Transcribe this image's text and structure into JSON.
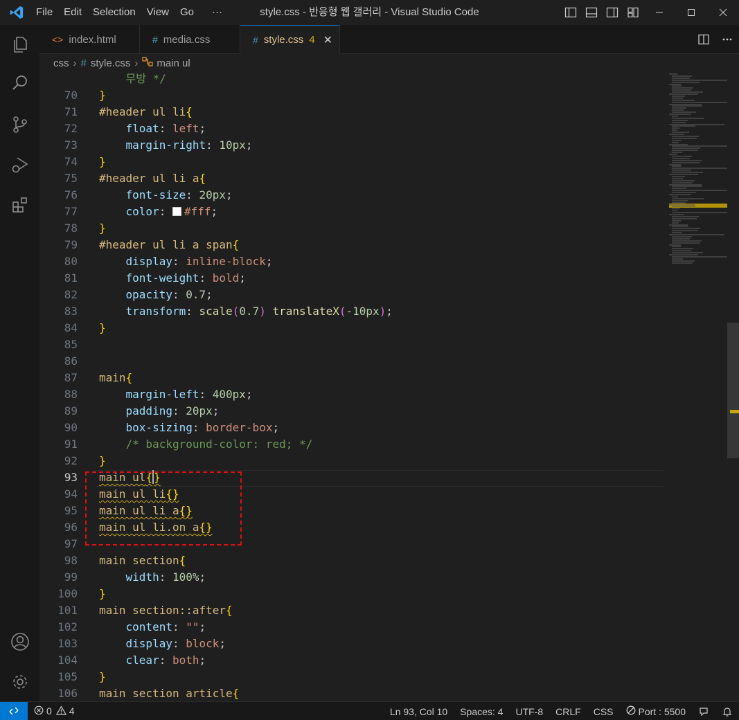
{
  "menu": [
    "File",
    "Edit",
    "Selection",
    "View",
    "Go",
    "···"
  ],
  "window_title": "style.css - 반응형 웹 갤러리 - Visual Studio Code",
  "tabs": [
    {
      "label": "index.html",
      "icon": "<>"
    },
    {
      "label": "media.css",
      "icon": "#"
    },
    {
      "label": "style.css",
      "icon": "#",
      "badge": "4",
      "close": "✕"
    }
  ],
  "breadcrumb": {
    "folder": "css",
    "file": "style.css",
    "symbol": "main ul"
  },
  "code_lines": [
    {
      "n": "",
      "tokens": [
        {
          "t": "    무방 */",
          "c": "cm"
        }
      ]
    },
    {
      "n": "70",
      "tokens": [
        {
          "t": "}",
          "c": "p1"
        }
      ]
    },
    {
      "n": "71",
      "tokens": [
        {
          "t": "#header ul li",
          "c": "sel"
        },
        {
          "t": "{",
          "c": "p1"
        }
      ]
    },
    {
      "n": "72",
      "tokens": [
        {
          "t": "    "
        },
        {
          "t": "float",
          "c": "prop"
        },
        {
          "t": ": ",
          "c": "plain"
        },
        {
          "t": "left",
          "c": "val"
        },
        {
          "t": ";",
          "c": "plain"
        }
      ]
    },
    {
      "n": "73",
      "tokens": [
        {
          "t": "    "
        },
        {
          "t": "margin-right",
          "c": "prop"
        },
        {
          "t": ": ",
          "c": "plain"
        },
        {
          "t": "10px",
          "c": "num"
        },
        {
          "t": ";",
          "c": "plain"
        }
      ]
    },
    {
      "n": "74",
      "tokens": [
        {
          "t": "}",
          "c": "p1"
        }
      ]
    },
    {
      "n": "75",
      "tokens": [
        {
          "t": "#header ul li a",
          "c": "sel"
        },
        {
          "t": "{",
          "c": "p1"
        }
      ]
    },
    {
      "n": "76",
      "tokens": [
        {
          "t": "    "
        },
        {
          "t": "font-size",
          "c": "prop"
        },
        {
          "t": ": ",
          "c": "plain"
        },
        {
          "t": "20px",
          "c": "num"
        },
        {
          "t": ";",
          "c": "plain"
        }
      ]
    },
    {
      "n": "77",
      "tokens": [
        {
          "t": "    "
        },
        {
          "t": "color",
          "c": "prop"
        },
        {
          "t": ": ",
          "c": "plain"
        },
        {
          "t": "",
          "c": "swatch"
        },
        {
          "t": "#fff",
          "c": "val"
        },
        {
          "t": ";",
          "c": "plain"
        }
      ]
    },
    {
      "n": "78",
      "tokens": [
        {
          "t": "}",
          "c": "p1"
        }
      ]
    },
    {
      "n": "79",
      "tokens": [
        {
          "t": "#header ul li a span",
          "c": "sel"
        },
        {
          "t": "{",
          "c": "p1"
        }
      ]
    },
    {
      "n": "80",
      "tokens": [
        {
          "t": "    "
        },
        {
          "t": "display",
          "c": "prop"
        },
        {
          "t": ": ",
          "c": "plain"
        },
        {
          "t": "inline-block",
          "c": "val"
        },
        {
          "t": ";",
          "c": "plain"
        }
      ]
    },
    {
      "n": "81",
      "tokens": [
        {
          "t": "    "
        },
        {
          "t": "font-weight",
          "c": "prop"
        },
        {
          "t": ": ",
          "c": "plain"
        },
        {
          "t": "bold",
          "c": "val"
        },
        {
          "t": ";",
          "c": "plain"
        }
      ]
    },
    {
      "n": "82",
      "tokens": [
        {
          "t": "    "
        },
        {
          "t": "opacity",
          "c": "prop"
        },
        {
          "t": ": ",
          "c": "plain"
        },
        {
          "t": "0.7",
          "c": "num"
        },
        {
          "t": ";",
          "c": "plain"
        }
      ]
    },
    {
      "n": "83",
      "tokens": [
        {
          "t": "    "
        },
        {
          "t": "transform",
          "c": "prop"
        },
        {
          "t": ": ",
          "c": "plain"
        },
        {
          "t": "scale",
          "c": "func"
        },
        {
          "t": "(",
          "c": "p2"
        },
        {
          "t": "0.7",
          "c": "num"
        },
        {
          "t": ")",
          "c": "p2"
        },
        {
          "t": " "
        },
        {
          "t": "translateX",
          "c": "func"
        },
        {
          "t": "(",
          "c": "p2"
        },
        {
          "t": "-10px",
          "c": "num"
        },
        {
          "t": ")",
          "c": "p2"
        },
        {
          "t": ";",
          "c": "plain"
        }
      ]
    },
    {
      "n": "84",
      "tokens": [
        {
          "t": "}",
          "c": "p1"
        }
      ]
    },
    {
      "n": "85",
      "tokens": []
    },
    {
      "n": "86",
      "tokens": []
    },
    {
      "n": "87",
      "tokens": [
        {
          "t": "main",
          "c": "sel"
        },
        {
          "t": "{",
          "c": "p1"
        }
      ]
    },
    {
      "n": "88",
      "tokens": [
        {
          "t": "    "
        },
        {
          "t": "margin-left",
          "c": "prop"
        },
        {
          "t": ": ",
          "c": "plain"
        },
        {
          "t": "400px",
          "c": "num"
        },
        {
          "t": ";",
          "c": "plain"
        }
      ]
    },
    {
      "n": "89",
      "tokens": [
        {
          "t": "    "
        },
        {
          "t": "padding",
          "c": "prop"
        },
        {
          "t": ": ",
          "c": "plain"
        },
        {
          "t": "20px",
          "c": "num"
        },
        {
          "t": ";",
          "c": "plain"
        }
      ]
    },
    {
      "n": "90",
      "tokens": [
        {
          "t": "    "
        },
        {
          "t": "box-sizing",
          "c": "prop"
        },
        {
          "t": ": ",
          "c": "plain"
        },
        {
          "t": "border-box",
          "c": "val"
        },
        {
          "t": ";",
          "c": "plain"
        }
      ]
    },
    {
      "n": "91",
      "tokens": [
        {
          "t": "    "
        },
        {
          "t": "/* background-color: red; */",
          "c": "cm"
        }
      ]
    },
    {
      "n": "92",
      "tokens": [
        {
          "t": "}",
          "c": "p1"
        }
      ]
    },
    {
      "n": "93",
      "current": true,
      "tokens": [
        {
          "t": "main ul",
          "c": "sel squig"
        },
        {
          "t": "{",
          "c": "p1 squig"
        },
        {
          "t": "",
          "c": "caret"
        },
        {
          "t": "}",
          "c": "p1 squig"
        }
      ]
    },
    {
      "n": "94",
      "tokens": [
        {
          "t": "main ul li",
          "c": "sel squig"
        },
        {
          "t": "{}",
          "c": "p1 squig"
        }
      ]
    },
    {
      "n": "95",
      "tokens": [
        {
          "t": "main ul li a",
          "c": "sel squig"
        },
        {
          "t": "{}",
          "c": "p1 squig"
        }
      ]
    },
    {
      "n": "96",
      "tokens": [
        {
          "t": "main ul li.on a",
          "c": "sel squig"
        },
        {
          "t": "{}",
          "c": "p1 squig"
        }
      ]
    },
    {
      "n": "97",
      "tokens": []
    },
    {
      "n": "98",
      "tokens": [
        {
          "t": "main section",
          "c": "sel"
        },
        {
          "t": "{",
          "c": "p1"
        }
      ]
    },
    {
      "n": "99",
      "tokens": [
        {
          "t": "    "
        },
        {
          "t": "width",
          "c": "prop"
        },
        {
          "t": ": ",
          "c": "plain"
        },
        {
          "t": "100%",
          "c": "num"
        },
        {
          "t": ";",
          "c": "plain"
        }
      ]
    },
    {
      "n": "100",
      "tokens": [
        {
          "t": "}",
          "c": "p1"
        }
      ]
    },
    {
      "n": "101",
      "tokens": [
        {
          "t": "main section::after",
          "c": "sel"
        },
        {
          "t": "{",
          "c": "p1"
        }
      ]
    },
    {
      "n": "102",
      "tokens": [
        {
          "t": "    "
        },
        {
          "t": "content",
          "c": "prop"
        },
        {
          "t": ": ",
          "c": "plain"
        },
        {
          "t": "\"\"",
          "c": "val"
        },
        {
          "t": ";",
          "c": "plain"
        }
      ]
    },
    {
      "n": "103",
      "tokens": [
        {
          "t": "    "
        },
        {
          "t": "display",
          "c": "prop"
        },
        {
          "t": ": ",
          "c": "plain"
        },
        {
          "t": "block",
          "c": "val"
        },
        {
          "t": ";",
          "c": "plain"
        }
      ]
    },
    {
      "n": "104",
      "tokens": [
        {
          "t": "    "
        },
        {
          "t": "clear",
          "c": "prop"
        },
        {
          "t": ": ",
          "c": "plain"
        },
        {
          "t": "both",
          "c": "val"
        },
        {
          "t": ";",
          "c": "plain"
        }
      ]
    },
    {
      "n": "105",
      "tokens": [
        {
          "t": "}",
          "c": "p1"
        }
      ]
    },
    {
      "n": "106",
      "tokens": [
        {
          "t": "main section article",
          "c": "sel"
        },
        {
          "t": "{",
          "c": "p1"
        }
      ]
    }
  ],
  "status": {
    "errors": "0",
    "warnings": "4",
    "position": "Ln 93, Col 10",
    "spaces": "Spaces: 4",
    "encoding": "UTF-8",
    "eol": "CRLF",
    "language": "CSS",
    "port": "Port : 5500"
  },
  "colors": {
    "accent": "#0078d4",
    "warning": "#cca700",
    "highlight_box": "#e01010"
  }
}
